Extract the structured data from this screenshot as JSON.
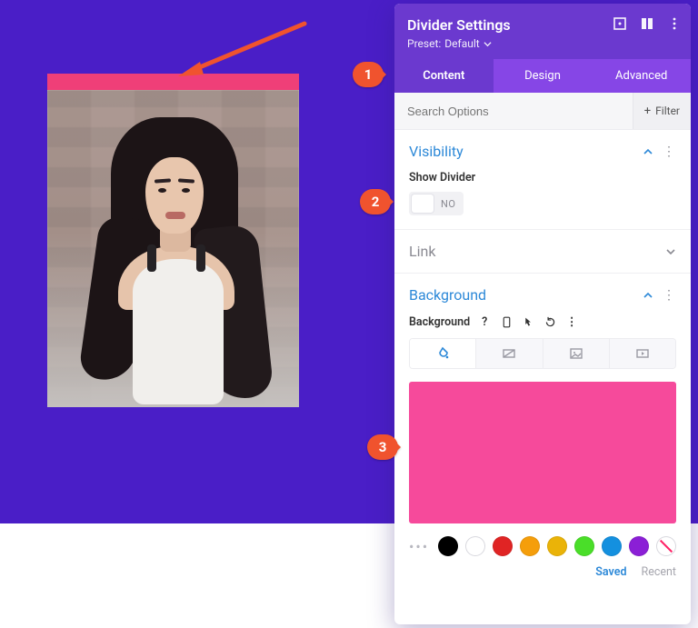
{
  "colors": {
    "canvas_bg": "#4a1ec7",
    "divider_bg": "#f64a9b",
    "panel_head": "#6b39cf",
    "panel_tabbar": "#8646e6",
    "accent_link": "#2d89d8",
    "callout": "#f0532e"
  },
  "callouts": [
    "1",
    "2",
    "3"
  ],
  "panel": {
    "title": "Divider Settings",
    "preset_label": "Preset:",
    "preset_value": "Default",
    "head_icons": [
      "expand-icon",
      "responsive-icon",
      "more-icon"
    ],
    "tabs": [
      "Content",
      "Design",
      "Advanced"
    ],
    "active_tab": 0,
    "search_placeholder": "Search Options",
    "filter_label": "Filter",
    "sections": {
      "visibility": {
        "title": "Visibility",
        "open": true,
        "field_label": "Show Divider",
        "toggle_text": "NO"
      },
      "link": {
        "title": "Link",
        "open": false
      },
      "background": {
        "title": "Background",
        "open": true,
        "field_label": "Background",
        "mini_icons": [
          "help-icon",
          "phone-icon",
          "hover-icon",
          "reset-icon",
          "more-icon"
        ],
        "bg_tabs": [
          "color-tab",
          "gradient-tab",
          "image-tab",
          "video-tab"
        ],
        "bg_active_tab": 0,
        "preview_color": "#f64a9b",
        "swatches": [
          "#000000",
          "#ffffff",
          "#e02424",
          "#f59e0b",
          "#eab308",
          "#4ade29",
          "#1490df",
          "#8b1fd6"
        ],
        "swatch_tabs": {
          "saved": "Saved",
          "recent": "Recent",
          "active": "saved"
        }
      }
    }
  }
}
